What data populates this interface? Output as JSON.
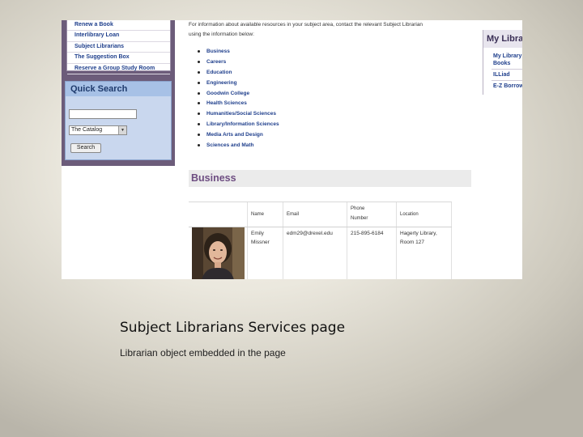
{
  "sidebar": {
    "links": [
      "Renew a Book",
      "Interlibrary Loan",
      "Subject Librarians",
      "The Suggestion Box",
      "Reserve a Group Study Room"
    ],
    "quick_search": {
      "title": "Quick Search",
      "input_value": "",
      "select_value": "The Catalog",
      "button_label": "Search"
    }
  },
  "intro": {
    "line1": "For information about available resources in your subject area, contact the relevant Subject Librarian",
    "line2": "using the information below:"
  },
  "subjects": [
    "Business",
    "Careers",
    "Education",
    "Engineering",
    "Goodwin College",
    "Health Sciences",
    "Humanities/Social Sciences",
    "Library/Information Sciences",
    "Media Arts and Design",
    "Sciences and Math"
  ],
  "my_library": {
    "title": "My Library",
    "items": [
      "My Library",
      "Books",
      "ILLiad",
      "E-Z Borrow"
    ]
  },
  "section": {
    "title": "Business",
    "table": {
      "headers": [
        "Name",
        "Email",
        "Phone Number",
        "Location"
      ],
      "row": {
        "name": "Emily Missner",
        "email": "edm29@drexel.edu",
        "phone": "215-895-6184",
        "location": "Hagerty Library, Room 127"
      }
    }
  },
  "caption": {
    "title": "Subject Librarians Services page",
    "subtitle": "Librarian object embedded in the page"
  },
  "colors": {
    "sidebar_purple": "#6c5c7a",
    "link_blue": "#1f3f8c",
    "section_heading": "#6e4e82",
    "quick_search_bg": "#c9d7ee"
  }
}
